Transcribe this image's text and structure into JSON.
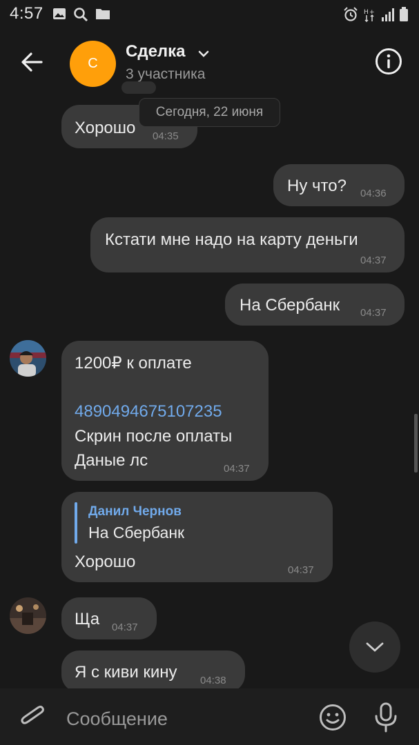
{
  "status_bar": {
    "time": "4:57"
  },
  "header": {
    "avatar_letter": "С",
    "title": "Сделка",
    "subtitle": "3 участника"
  },
  "date_divider": "Сегодня, 22 июня",
  "messages": [
    {
      "text": "Хорошо",
      "time": "04:35"
    },
    {
      "text": "Ну что?",
      "time": "04:36"
    },
    {
      "text": "Кстати мне надо на карту деньги",
      "time": "04:37"
    },
    {
      "text": "На Сбербанк",
      "time": "04:37"
    },
    {
      "lines": [
        "1200₽ к оплате",
        "",
        "4890494675107235",
        "Скрин после оплаты",
        "Даные лс"
      ],
      "time": "04:37"
    },
    {
      "reply_author": "Данил Чернов",
      "reply_text": "На Сбербанк",
      "text": "Хорошо",
      "time": "04:37"
    },
    {
      "text": "Ща",
      "time": "04:37"
    },
    {
      "text": "Я с киви кину",
      "time": "04:38"
    }
  ],
  "composer": {
    "placeholder": "Сообщение"
  },
  "colors": {
    "background": "#191919",
    "bubble": "#3a3a3a",
    "accent": "#71aaeb",
    "avatar": "#ff9f0a"
  }
}
